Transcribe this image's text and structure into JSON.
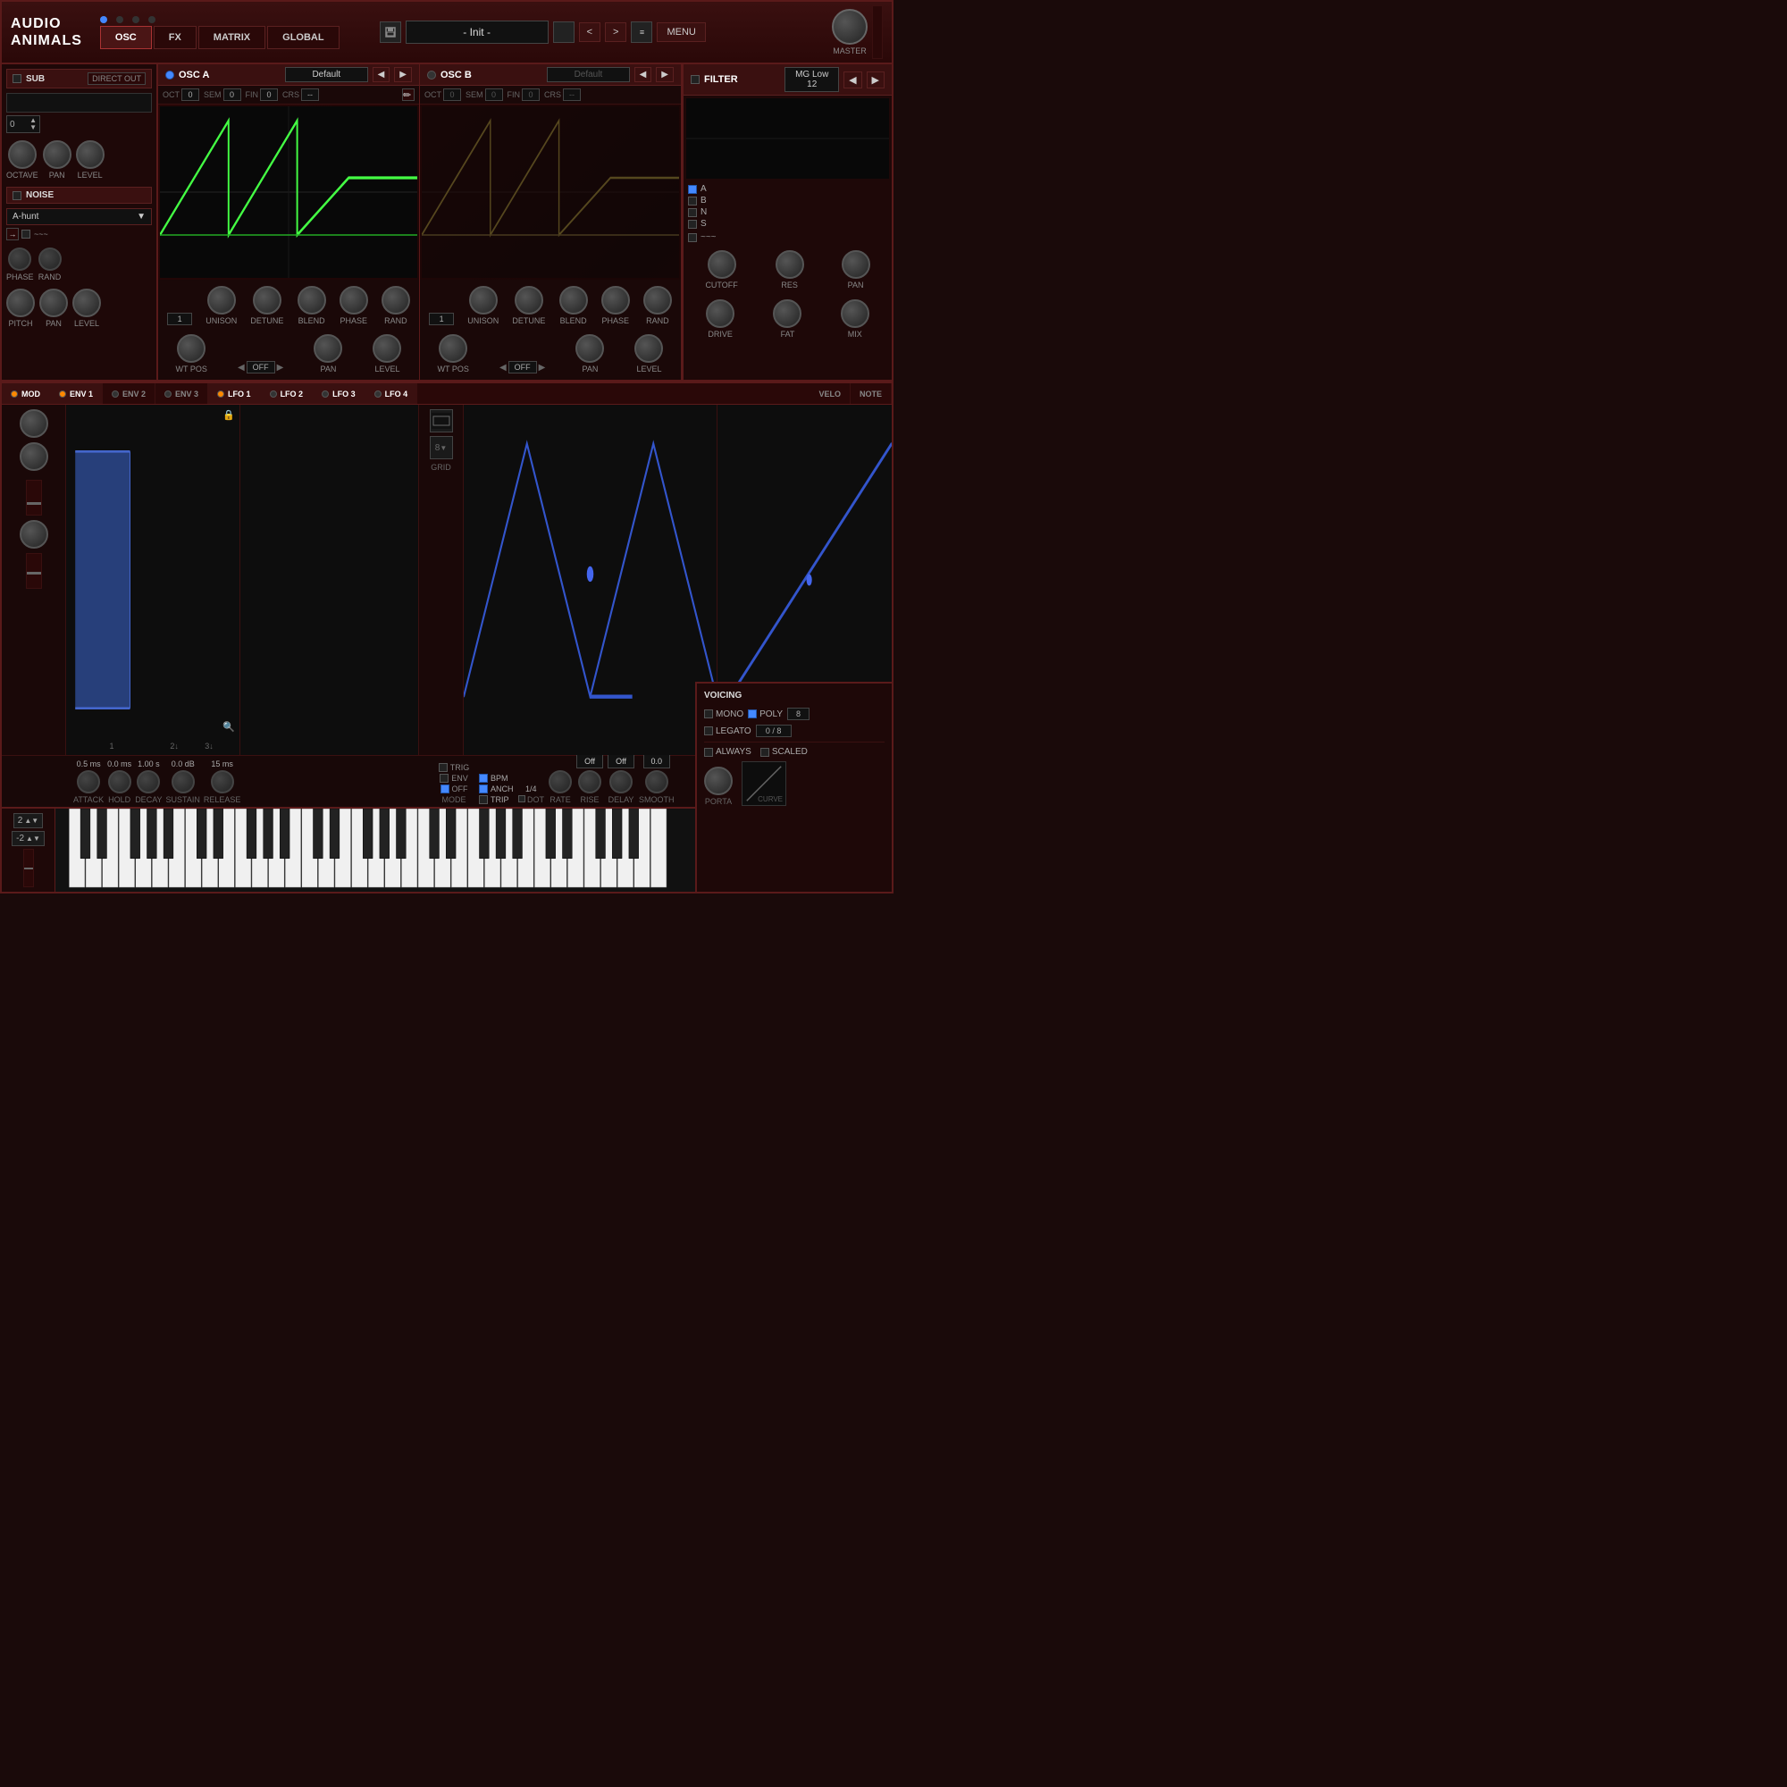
{
  "app": {
    "title": "Audio Animals",
    "logo_line1": "AUDIO",
    "logo_line2": "ANIMALS"
  },
  "nav": {
    "tabs": [
      "OSC",
      "FX",
      "MATRIX",
      "GLOBAL"
    ],
    "active_tab": "OSC"
  },
  "preset": {
    "name": "- Init -",
    "prev_label": "<",
    "next_label": ">",
    "menu_label": "MENU"
  },
  "master": {
    "label": "MASTER"
  },
  "sub": {
    "label": "SUB",
    "badge": "DIRECT OUT",
    "octave_label": "OCTAVE",
    "pan_label": "PAN",
    "level_label": "LEVEL",
    "octave_value": "0"
  },
  "noise": {
    "label": "NOISE",
    "type": "A-hunt",
    "phase_label": "PHASE",
    "rand_label": "RAND",
    "pitch_label": "PITCH",
    "pan_label": "PAN",
    "level_label": "LEVEL"
  },
  "osc_a": {
    "title": "OSC A",
    "waveform": "Default",
    "oct_label": "OCT",
    "oct_value": "0",
    "sem_label": "SEM",
    "sem_value": "0",
    "fin_label": "FIN",
    "fin_value": "0",
    "crs_label": "CRS",
    "crs_value": "--",
    "unison_label": "UNISON",
    "detune_label": "DETUNE",
    "blend_label": "BLEND",
    "phase_label": "PHASE",
    "rand_label": "RAND",
    "wtpos_label": "WT POS",
    "off_label": "OFF",
    "pan_label": "PAN",
    "level_label": "LEVEL",
    "unison_value": "1"
  },
  "osc_b": {
    "title": "OSC B",
    "waveform": "Default",
    "oct_label": "OCT",
    "oct_value": "0",
    "sem_label": "SEM",
    "sem_value": "0",
    "fin_label": "FIN",
    "fin_value": "0",
    "crs_label": "CRS",
    "crs_value": "--",
    "unison_label": "UNISON",
    "detune_label": "DETUNE",
    "blend_label": "BLEND",
    "phase_label": "PHASE",
    "rand_label": "RAND",
    "wtpos_label": "WT POS",
    "off_label": "OFF",
    "pan_label": "PAN",
    "level_label": "LEVEL",
    "unison_value": "1"
  },
  "filter": {
    "label": "FILTER",
    "type": "MG Low 12",
    "prev_label": "<",
    "next_label": ">",
    "a_label": "A",
    "b_label": "B",
    "n_label": "N",
    "s_label": "S",
    "cutoff_label": "CUTOFF",
    "res_label": "RES",
    "pan_label": "PAN",
    "drive_label": "DRIVE",
    "fat_label": "FAT",
    "mix_label": "MIX"
  },
  "mod_section": {
    "label": "MOD"
  },
  "env1": {
    "label": "ENV 1",
    "attack_val": "0.5 ms",
    "hold_val": "0.0 ms",
    "decay_val": "1.00 s",
    "sustain_val": "0.0 dB",
    "release_val": "15 ms",
    "attack_label": "ATTACK",
    "hold_label": "HOLD",
    "decay_label": "DECAY",
    "sustain_label": "SUSTAIN",
    "release_label": "RELEASE"
  },
  "env2": {
    "label": "ENV 2"
  },
  "env3": {
    "label": "ENV 3"
  },
  "lfo1": {
    "label": "LFO 1",
    "grid_label": "GRID",
    "grid_value": "8"
  },
  "lfo2": {
    "label": "LFO 2"
  },
  "lfo3": {
    "label": "LFO 3"
  },
  "lfo4": {
    "label": "LFO 4"
  },
  "velo": {
    "label": "VELO"
  },
  "note": {
    "label": "NOTE"
  },
  "lfo_controls": {
    "trig_label": "TRIG",
    "env_label": "ENV",
    "off_label": "OFF",
    "bpm_label": "BPM",
    "anch_label": "ANCH",
    "trip_label": "TRIP",
    "dot_label": "DOT",
    "rate_label": "RATE",
    "rise_label": "RISE",
    "delay_label": "DELAY",
    "smooth_label": "SMOOTH",
    "mode_label": "MODE",
    "fraction": "1/4",
    "off_val1": "Off",
    "off_val2": "Off",
    "smooth_val": "0.0"
  },
  "voicing": {
    "title": "VOICING",
    "mono_label": "MONO",
    "poly_label": "POLY",
    "poly_value": "8",
    "legato_label": "LEGATO",
    "legato_value": "0 / 8",
    "always_label": "ALWAYS",
    "scaled_label": "SCALED",
    "porta_label": "PORTA",
    "curve_label": "CURVE"
  },
  "keyboard": {
    "pitch_up": "2",
    "pitch_down": "-2"
  }
}
